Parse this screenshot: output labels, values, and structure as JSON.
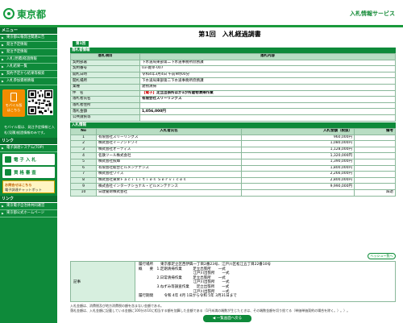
{
  "header": {
    "logo_text": "東京都",
    "service_title": "入札情報サービス"
  },
  "sidebar": {
    "menu_heading": "メニュー",
    "items": [
      {
        "label": "東京都公報発注関連公告"
      },
      {
        "label": "発注予定情報"
      },
      {
        "label": "発注予定情報"
      },
      {
        "label": "入札(見積)経過情報"
      },
      {
        "label": "入札結果一覧"
      },
      {
        "label": "契約予定から結果等検索"
      },
      {
        "label": "入札参加資格情報"
      }
    ],
    "mobile_label_1": "モバイル版",
    "mobile_label_2": "はこちら",
    "mobile_note": "モバイル版は、発注予定情報と入札(見積)経過情報のみです。",
    "links_heading": "リンク",
    "link_items": [
      {
        "label": "電子調達システム(TOP)"
      }
    ],
    "big_buttons": [
      {
        "label": "電 子 入 札"
      },
      {
        "label": "資 格 審 査"
      }
    ],
    "chat_line1": "お問合せはこちら",
    "chat_line2": "電子調達チャットボット",
    "bottom_heading": "リンク",
    "bottom_items": [
      {
        "label": "東京電子自治体共同運営"
      },
      {
        "label": "東京都公式ホームページ"
      }
    ]
  },
  "main": {
    "page_title": "第1回　入札経過調書",
    "tab_label": "第1回",
    "project_section_title": "落札者情報",
    "project_header": {
      "item": "落札項目",
      "content": "落札内容"
    },
    "project_rows": [
      {
        "label": "契約部署",
        "value": "下水道局東部第二下水道事務所庶務課"
      },
      {
        "label": "契約番号",
        "value": "03-雑単-007"
      },
      {
        "label": "開札日時",
        "value": "令和4年3月4日 午前9時00分"
      },
      {
        "label": "開札場所",
        "value": "下水道局東部第二下水道事務所庶務課"
      },
      {
        "label": "業種",
        "value": "建物清掃"
      },
      {
        "label": "件　名",
        "tag": "【電子】",
        "value": "足立出張所ほか1か所建物清掃作業"
      },
      {
        "label": "落札者氏名",
        "value": "有限会社スリーリングス"
      },
      {
        "label": "落札者住所",
        "value": ""
      },
      {
        "label": "落札金額",
        "value": "1,056,000円"
      },
      {
        "label": "公共請負等",
        "value": ""
      }
    ],
    "bid_section_title": "入札情報",
    "bid_header": {
      "no": "No",
      "name": "入札者氏名",
      "amount": "入札金額（税抜）",
      "note": "備考"
    },
    "bids": [
      {
        "no": "1",
        "name": "有限会社スリーリングス",
        "amount": "960,000円",
        "note": ""
      },
      {
        "no": "2",
        "name": "株式会社イーアンドワイ",
        "amount": "1,080,000円",
        "note": ""
      },
      {
        "no": "3",
        "name": "株式会社オーティス",
        "amount": "1,128,000円",
        "note": ""
      },
      {
        "no": "4",
        "name": "名鉄ツール株式会社",
        "amount": "1,320,000円",
        "note": ""
      },
      {
        "no": "5",
        "name": "株式会社照輝",
        "amount": "1,390,000円",
        "note": ""
      },
      {
        "no": "6",
        "name": "有限会社総合ビルメンテナンス",
        "amount": "1,800,000円",
        "note": ""
      },
      {
        "no": "7",
        "name": "株式会社ワイズ",
        "amount": "2,266,000円",
        "note": ""
      },
      {
        "no": "8",
        "name": "株式会社東栄Ｆａｃｉｌｉｔｉｅｓ Ｓｅｒｖｉｃｅｓ",
        "amount": "2,800,000円",
        "note": ""
      },
      {
        "no": "9",
        "name": "株式会社インターナショナル・ビルメンテナンス",
        "amount": "9,990,000円",
        "note": ""
      },
      {
        "no": "10",
        "name": "日建警財株式会社",
        "amount": "",
        "note": "辞退"
      }
    ],
    "history_button": "ヘッシュー覧へ",
    "remarks_label": "記事",
    "remarks_text": "履行場所　　東京都足立区西伊興一丁目2番23号、江戸川区松江五丁目22番10号\n概　　要　1.定期清掃作業　　　足立出張所　　一式\n　　　　　　　　　　　　　　　江戸川出張所　　一式\n　　　　　2.日常清掃作業　　　足立出張所　　一式\n　　　　　　　　　　　　　　　江戸川出張所　　一式\n　　　　　3.ねずみ等調査作業　　足立出張所　　一式\n　　　　　　　　　　　　　　　江戸川出張所　　一式\n履行期間　　　令和 4年 4月 1日から令和 5年 3月31日まで",
    "footnote_1": "入札金額は、消費税及び地方消費税の額を含まない金額である。",
    "footnote_2": "落札金額は、入札金額に記載している金額に100分の10に相当する額を加算した金額である（1円未満の端数が生じたときは、その端数金額を切り捨てる（単価単価契約の場合を除く。）。）。",
    "back_button": "◀ 一覧画面へ戻る"
  },
  "colors": {
    "brand_green": "#0e8a3a",
    "accent_red": "#d00000"
  }
}
